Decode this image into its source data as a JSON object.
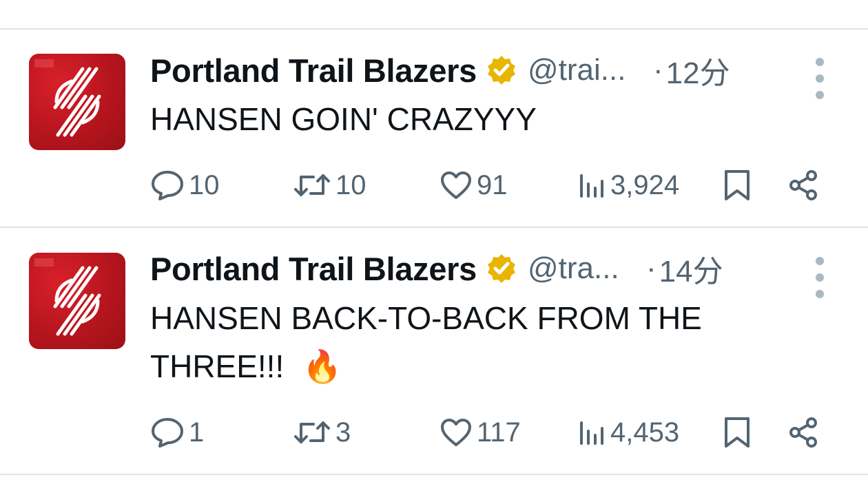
{
  "colors": {
    "text": "#0f1419",
    "secondary": "#536471",
    "divider": "#dfe3e6",
    "verified_gold": "#e8b500",
    "avatar_red": "#c8171f"
  },
  "tweets": [
    {
      "author": "Portland Trail Blazers",
      "handle": "@trai...",
      "separator": "·",
      "time": "12分",
      "text_lines": [
        "HANSEN GOIN' CRAZYYY"
      ],
      "emoji": "",
      "replies": "10",
      "retweets": "10",
      "likes": "91",
      "views": "3,924",
      "icons": [
        "reply-icon",
        "retweet-icon",
        "like-icon",
        "views-icon",
        "bookmark-icon",
        "share-icon"
      ]
    },
    {
      "author": "Portland Trail Blazers",
      "handle": "@tra...",
      "separator": "·",
      "time": "14分",
      "text_lines": [
        "HANSEN BACK-TO-BACK FROM THE",
        "THREE!!!"
      ],
      "emoji": "🔥",
      "replies": "1",
      "retweets": "3",
      "likes": "117",
      "views": "4,453",
      "icons": [
        "reply-icon",
        "retweet-icon",
        "like-icon",
        "views-icon",
        "bookmark-icon",
        "share-icon"
      ]
    }
  ]
}
